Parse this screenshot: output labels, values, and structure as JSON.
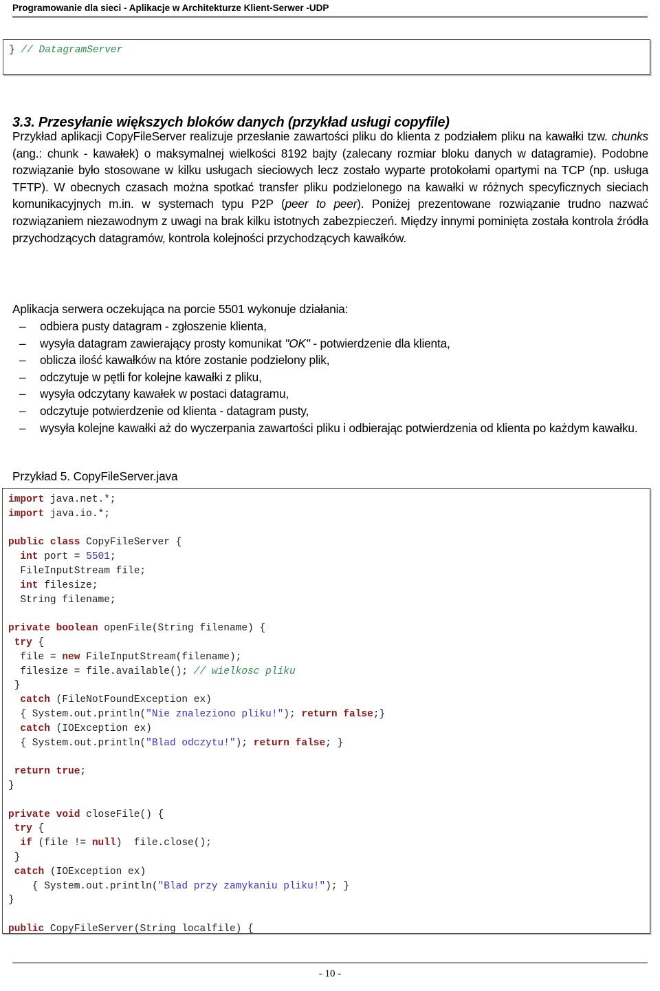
{
  "header": {
    "title": "Programowanie dla sieci - Aplikacje w Architekturze Klient-Serwer -UDP"
  },
  "top_code_box": {
    "lines": [
      {
        "segments": [
          {
            "t": "} ",
            "c": "plain"
          },
          {
            "t": "// DatagramServer",
            "c": "cmt"
          }
        ]
      }
    ]
  },
  "section": {
    "number": "3.3.",
    "heading": "3.3. Przesyłanie większych bloków danych (przykład usługi copyfile)"
  },
  "paragraph_1": "Przykład aplikacji CopyFileServer realizuje przesłanie zawartości pliku do klienta z podziałem pliku na kawałki tzw. chunks (ang.: chunk - kawałek) o maksymalnej wielkości 8192 bajty (zalecany rozmiar bloku danych w datagramie). Podobne rozwiązanie było stosowane w kilku usługach sieciowych lecz zostało wyparte protokołami opartymi na TCP (np. usługa TFTP). W obecnych czasach można spotkać transfer pliku podzielonego na kawałki w różnych specyficznych sieciach komunikacyjnych m.in. w systemach typu P2P (peer to peer). Poniżej prezentowane rozwiązanie trudno nazwać rozwiązaniem niezawodnym z uwagi na brak kilku istotnych zabezpieczeń. Między innymi pominięta została kontrola źródła przychodzących datagramów, kontrola kolejności przychodzących kawałków.",
  "paragraph_2": "Aplikacja serwera oczekująca na porcie 5501 wykonuje działania:",
  "bullets": {
    "marker": "–",
    "items": [
      "odbiera pusty datagram - zgłoszenie klienta,",
      "wysyła datagram zawierający prosty komunikat \"OK\" - potwierdzenie dla klienta,",
      "oblicza ilość kawałków na które zostanie podzielony plik,",
      "odczytuje w pętli for kolejne kawałki z pliku,",
      "wysyła odczytany kawałek w postaci datagramu,",
      "odczytuje potwierdzenie od klienta - datagram pusty,",
      "wysyła kolejne kawałki aż do wyczerpania zawartości pliku i odbierając potwierdzenia od klienta po każdym kawałku."
    ]
  },
  "example_caption": "Przykład 5. CopyFileServer.java",
  "main_code_box": {
    "lines": [
      {
        "segments": [
          {
            "t": "import",
            "c": "kw"
          },
          {
            "t": " java.net.*;",
            "c": "plain"
          }
        ]
      },
      {
        "segments": [
          {
            "t": "import",
            "c": "kw"
          },
          {
            "t": " java.io.*;",
            "c": "plain"
          }
        ]
      },
      {
        "segments": [
          {
            "t": "",
            "c": "plain"
          }
        ]
      },
      {
        "segments": [
          {
            "t": "public class",
            "c": "kw"
          },
          {
            "t": " CopyFileServer {",
            "c": "plain"
          }
        ]
      },
      {
        "segments": [
          {
            "t": "  ",
            "c": "plain"
          },
          {
            "t": "int",
            "c": "kw"
          },
          {
            "t": " port = ",
            "c": "plain"
          },
          {
            "t": "5501",
            "c": "num"
          },
          {
            "t": ";",
            "c": "plain"
          }
        ]
      },
      {
        "segments": [
          {
            "t": "  FileInputStream file;",
            "c": "plain"
          }
        ]
      },
      {
        "segments": [
          {
            "t": "  ",
            "c": "plain"
          },
          {
            "t": "int",
            "c": "kw"
          },
          {
            "t": " filesize;",
            "c": "plain"
          }
        ]
      },
      {
        "segments": [
          {
            "t": "  String filename;",
            "c": "plain"
          }
        ]
      },
      {
        "segments": [
          {
            "t": "",
            "c": "plain"
          }
        ]
      },
      {
        "segments": [
          {
            "t": "private boolean",
            "c": "kw"
          },
          {
            "t": " openFile(String filename) {",
            "c": "plain"
          }
        ]
      },
      {
        "segments": [
          {
            "t": " ",
            "c": "plain"
          },
          {
            "t": "try",
            "c": "kw"
          },
          {
            "t": " {",
            "c": "plain"
          }
        ]
      },
      {
        "segments": [
          {
            "t": "  file = ",
            "c": "plain"
          },
          {
            "t": "new",
            "c": "kw"
          },
          {
            "t": " FileInputStream(filename);",
            "c": "plain"
          }
        ]
      },
      {
        "segments": [
          {
            "t": "  filesize = file.available(); ",
            "c": "plain"
          },
          {
            "t": "// wielkosc pliku",
            "c": "cmt"
          }
        ]
      },
      {
        "segments": [
          {
            "t": " }",
            "c": "plain"
          }
        ]
      },
      {
        "segments": [
          {
            "t": "  ",
            "c": "plain"
          },
          {
            "t": "catch",
            "c": "kw"
          },
          {
            "t": " (FileNotFoundException ex)",
            "c": "plain"
          }
        ]
      },
      {
        "segments": [
          {
            "t": "  { System.out.println(",
            "c": "plain"
          },
          {
            "t": "\"Nie znaleziono pliku!\"",
            "c": "str"
          },
          {
            "t": "); ",
            "c": "plain"
          },
          {
            "t": "return false",
            "c": "kw"
          },
          {
            "t": ";}",
            "c": "plain"
          }
        ]
      },
      {
        "segments": [
          {
            "t": "  ",
            "c": "plain"
          },
          {
            "t": "catch",
            "c": "kw"
          },
          {
            "t": " (IOException ex)",
            "c": "plain"
          }
        ]
      },
      {
        "segments": [
          {
            "t": "  { System.out.println(",
            "c": "plain"
          },
          {
            "t": "\"Blad odczytu!\"",
            "c": "str"
          },
          {
            "t": "); ",
            "c": "plain"
          },
          {
            "t": "return false",
            "c": "kw"
          },
          {
            "t": "; }",
            "c": "plain"
          }
        ]
      },
      {
        "segments": [
          {
            "t": "",
            "c": "plain"
          }
        ]
      },
      {
        "segments": [
          {
            "t": " ",
            "c": "plain"
          },
          {
            "t": "return true",
            "c": "kw"
          },
          {
            "t": ";",
            "c": "plain"
          }
        ]
      },
      {
        "segments": [
          {
            "t": "}",
            "c": "plain"
          }
        ]
      },
      {
        "segments": [
          {
            "t": "",
            "c": "plain"
          }
        ]
      },
      {
        "segments": [
          {
            "t": "private void",
            "c": "kw"
          },
          {
            "t": " closeFile() {",
            "c": "plain"
          }
        ]
      },
      {
        "segments": [
          {
            "t": " ",
            "c": "plain"
          },
          {
            "t": "try",
            "c": "kw"
          },
          {
            "t": " {",
            "c": "plain"
          }
        ]
      },
      {
        "segments": [
          {
            "t": "  ",
            "c": "plain"
          },
          {
            "t": "if",
            "c": "kw"
          },
          {
            "t": " (file != ",
            "c": "plain"
          },
          {
            "t": "null",
            "c": "kw"
          },
          {
            "t": ")  file.close();",
            "c": "plain"
          }
        ]
      },
      {
        "segments": [
          {
            "t": " }",
            "c": "plain"
          }
        ]
      },
      {
        "segments": [
          {
            "t": " ",
            "c": "plain"
          },
          {
            "t": "catch",
            "c": "kw"
          },
          {
            "t": " (IOException ex)",
            "c": "plain"
          }
        ]
      },
      {
        "segments": [
          {
            "t": "    { System.out.println(",
            "c": "plain"
          },
          {
            "t": "\"Blad przy zamykaniu pliku!\"",
            "c": "str"
          },
          {
            "t": "); }",
            "c": "plain"
          }
        ]
      },
      {
        "segments": [
          {
            "t": "}",
            "c": "plain"
          }
        ]
      },
      {
        "segments": [
          {
            "t": "",
            "c": "plain"
          }
        ]
      },
      {
        "segments": [
          {
            "t": "public",
            "c": "kw"
          },
          {
            "t": " CopyFileServer(String localfile) {",
            "c": "plain"
          }
        ]
      }
    ]
  },
  "footer": {
    "page_label": "- 10 -"
  },
  "colors": {
    "keyword": "#8b1a1a",
    "string": "#3333cc",
    "number": "#3333aa",
    "comment": "#2e8b4f",
    "rule": "#9a9a9a",
    "box_border": "#4a4a4a"
  }
}
